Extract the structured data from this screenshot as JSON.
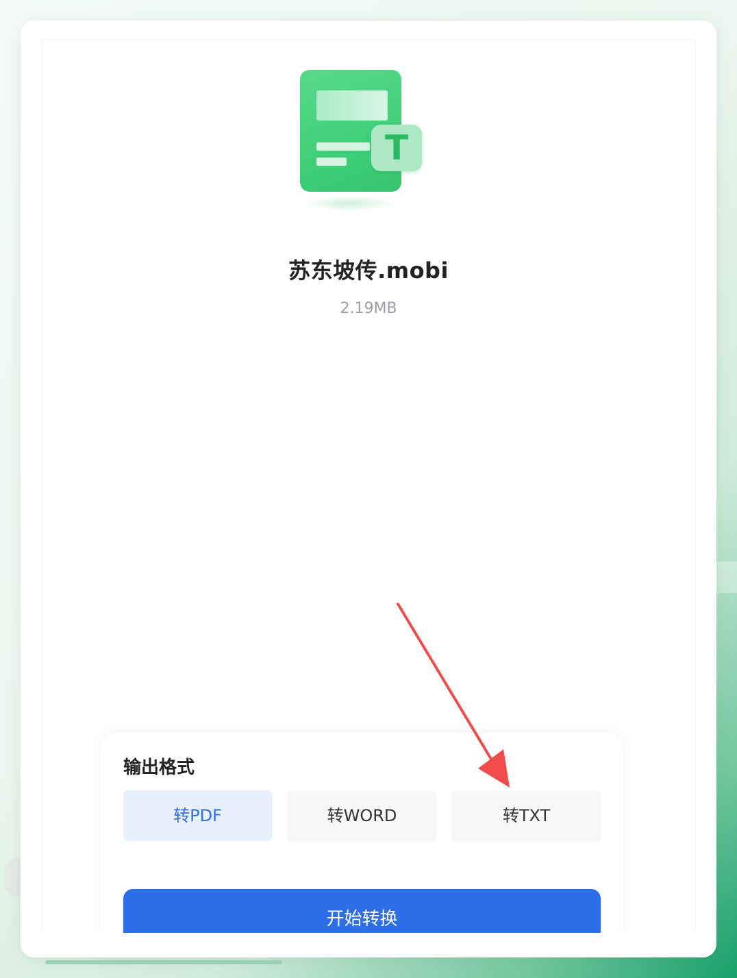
{
  "file": {
    "icon": "text-file-icon",
    "badge_letter": "T",
    "name": "苏东坡传.mobi",
    "size": "2.19MB"
  },
  "output": {
    "title": "输出格式",
    "formats": [
      {
        "label": "转PDF",
        "selected": true
      },
      {
        "label": "转WORD",
        "selected": false
      },
      {
        "label": "转TXT",
        "selected": false
      }
    ]
  },
  "actions": {
    "start_label": "开始转换"
  },
  "annotation": {
    "icon": "red-arrow-icon",
    "color": "#f24b4b"
  },
  "colors": {
    "accent_blue": "#2d6ee8",
    "file_green": "#3fcf78",
    "selected_bg": "#e8f0fe"
  }
}
